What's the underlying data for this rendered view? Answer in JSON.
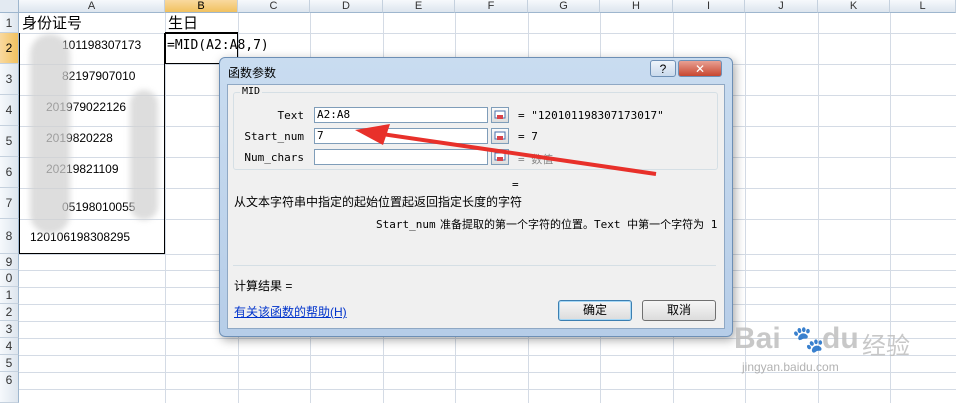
{
  "spreadsheet": {
    "columns": [
      "A",
      "B",
      "C",
      "D",
      "E",
      "F",
      "G",
      "H",
      "I",
      "J",
      "K",
      "L"
    ],
    "rows": [
      "1",
      "2",
      "3",
      "4",
      "5",
      "6",
      "7",
      "8",
      "9",
      "10",
      "11",
      "12",
      "13",
      "14",
      "15",
      "16"
    ],
    "row_labels_visible": [
      "1",
      "2",
      "3",
      "4",
      "5",
      "6",
      "7",
      "8",
      "9",
      "0",
      "1",
      "2",
      "3",
      "4",
      "5",
      "6"
    ],
    "header_id": "身份证号",
    "header_birthday": "生日",
    "formula_cell": "=MID(A2:A8,7)",
    "id_values": [
      "101198307173",
      "82197907010",
      "201979022126",
      "2019820228",
      "20219821109",
      "05198010055",
      "120106198308295"
    ]
  },
  "dialog": {
    "title": "函数参数",
    "help_btn": "?",
    "close_btn": "✕",
    "group_label": "MID",
    "args": [
      {
        "label": "Text",
        "value": "A2:A8",
        "result": "= \"120101198307173017\""
      },
      {
        "label": "Start_num",
        "value": "7",
        "result": "= 7"
      },
      {
        "label": "Num_chars",
        "value": "",
        "result": "= 数值"
      }
    ],
    "total_eq": "=",
    "description": "从文本字符串中指定的起始位置起返回指定长度的字符",
    "arg_name": "Start_num",
    "arg_desc": "准备提取的第一个字符的位置。Text 中第一个字符为 1",
    "calc_result": "计算结果 =",
    "help_link": "有关该函数的帮助(H)",
    "ok": "确定",
    "cancel": "取消"
  },
  "watermark": {
    "brand": "Bai",
    "brand2": "du",
    "cn": "经验",
    "url": "jingyan.baidu.com"
  }
}
